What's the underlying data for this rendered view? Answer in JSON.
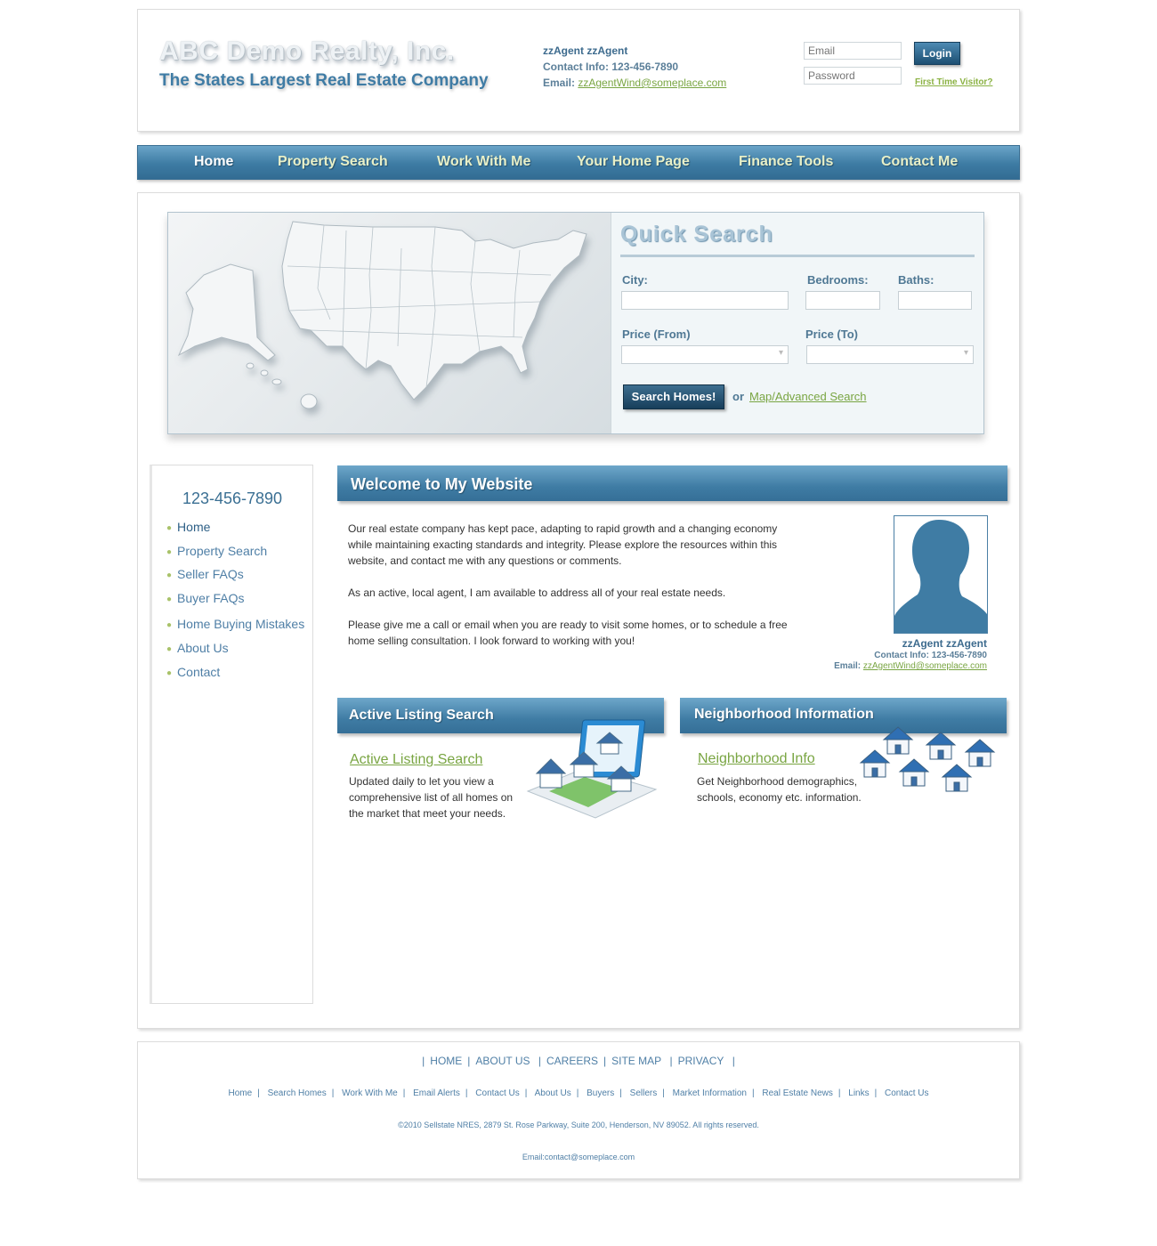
{
  "header": {
    "company_name": "ABC Demo Realty, Inc.",
    "tagline": "The States Largest Real Estate Company",
    "agent_name": "zzAgent zzAgent",
    "contact_info_label": "Contact Info:",
    "contact_info_value": "123-456-7890",
    "email_label": "Email:",
    "email_value": "zzAgentWind@someplace.com",
    "login": {
      "email_placeholder": "Email",
      "password_placeholder": "Password",
      "login_button": "Login",
      "first_time_link": "First Time Visitor?"
    }
  },
  "nav": {
    "items": [
      "Home",
      "Property Search",
      "Work With Me",
      "Your Home Page",
      "Finance Tools",
      "Contact Me"
    ],
    "active": "Home"
  },
  "quick_search": {
    "title": "Quick Search",
    "city_label": "City:",
    "bedrooms_label": "Bedrooms:",
    "baths_label": "Baths:",
    "price_from_label": "Price (From)",
    "price_to_label": "Price (To)",
    "search_button": "Search Homes!",
    "or_text": "or",
    "advanced_link": "Map/Advanced Search"
  },
  "sidebar": {
    "phone": "123-456-7890",
    "items": [
      "Home",
      "Property Search",
      "Seller FAQs",
      "Buyer FAQs",
      "Home Buying Mistakes",
      "About Us",
      "Contact"
    ]
  },
  "welcome": {
    "title": "Welcome to My Website",
    "paragraphs": [
      "Our real estate company has kept pace, adapting to rapid growth and a changing economy while maintaining exacting standards and integrity. Please explore the resources within this website, and contact me with any questions or comments.",
      "As an active, local agent, I am available to address all of your real estate needs.",
      "Please give me a call or email when you are ready to visit some homes, or to schedule a free home selling consultation. I look forward to working with you!"
    ],
    "agent_card": {
      "name": "zzAgent zzAgent",
      "contact_label": "Contact Info:",
      "contact_value": "123-456-7890",
      "email_label": "Email:",
      "email_value": "zzAgentWind@someplace.com"
    }
  },
  "features": {
    "active_listing": {
      "header": "Active Listing Search",
      "link": "Active Listing Search",
      "text": "Updated daily to let you view a comprehensive list of all homes on the market that meet your needs."
    },
    "neighborhood": {
      "header": "Neighborhood Information",
      "link": "Neighborhood Info",
      "text": "Get Neighborhood demographics, schools, economy etc. information."
    }
  },
  "footer": {
    "main_links": [
      "HOME",
      "ABOUT US",
      "CAREERS",
      "SITE MAP",
      "PRIVACY"
    ],
    "sub_links": [
      "Home",
      "Search Homes",
      "Work With Me",
      "Email Alerts",
      "Contact Us",
      "About Us",
      "Buyers",
      "Sellers",
      "Market Information",
      "Real Estate News",
      "Links",
      "Contact Us"
    ],
    "copyright": "©2010 Sellstate NRES, 2879 St. Rose Parkway, Suite 200, Henderson, NV 89052. All rights reserved.",
    "email": "Email:contact@someplace.com"
  },
  "colors": {
    "brand_blue": "#3f7ca4",
    "link_green": "#79a542",
    "nav_text": "#e8f0c8"
  }
}
